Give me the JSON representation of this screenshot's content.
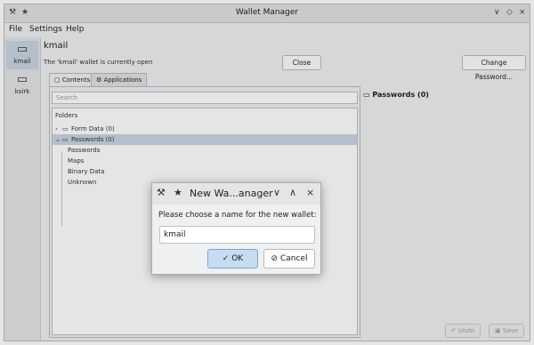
{
  "window": {
    "title": "Wallet Manager"
  },
  "titlebar": {
    "minimize_icon": "∨",
    "maximize_icon": "◇",
    "close_icon": "×",
    "app_icon": "⚒",
    "pin_icon": "★"
  },
  "menubar": {
    "items": [
      "File",
      "Settings",
      "Help"
    ]
  },
  "sidebar": {
    "wallets": [
      {
        "label": "kmail",
        "icon": "▭"
      },
      {
        "label": "ksirk",
        "icon": "▭"
      }
    ]
  },
  "header": {
    "wallet_name": "kmail",
    "status": "The 'kmail' wallet is currently open",
    "close_label": "Close",
    "change_password_label": "Change Password..."
  },
  "tabs": [
    {
      "label": "Contents",
      "icon": "▢"
    },
    {
      "label": "Applications",
      "icon": "⚙"
    }
  ],
  "search": {
    "placeholder": "Search"
  },
  "folders": {
    "header": "Folders",
    "items": [
      {
        "label": "Form Data (0)"
      },
      {
        "label": "Passwords (0)"
      },
      {
        "label": "Passwords"
      },
      {
        "label": "Maps"
      },
      {
        "label": "Binary Data"
      },
      {
        "label": "Unknown"
      }
    ]
  },
  "right_panel": {
    "title": "Passwords (0)"
  },
  "bottom": {
    "undo_label": "Undo",
    "save_label": "Save"
  },
  "dialog": {
    "title": "New Wa...anager",
    "prompt": "Please choose a name for the new wallet:",
    "input_value": "kmail",
    "ok_label": "OK",
    "cancel_label": "Cancel",
    "ok_icon": "✓",
    "cancel_icon": "⊘"
  },
  "colors": {
    "accent": "#3daee9",
    "selection": "#c9d5e3",
    "ok_button": "#c6dcf0"
  }
}
